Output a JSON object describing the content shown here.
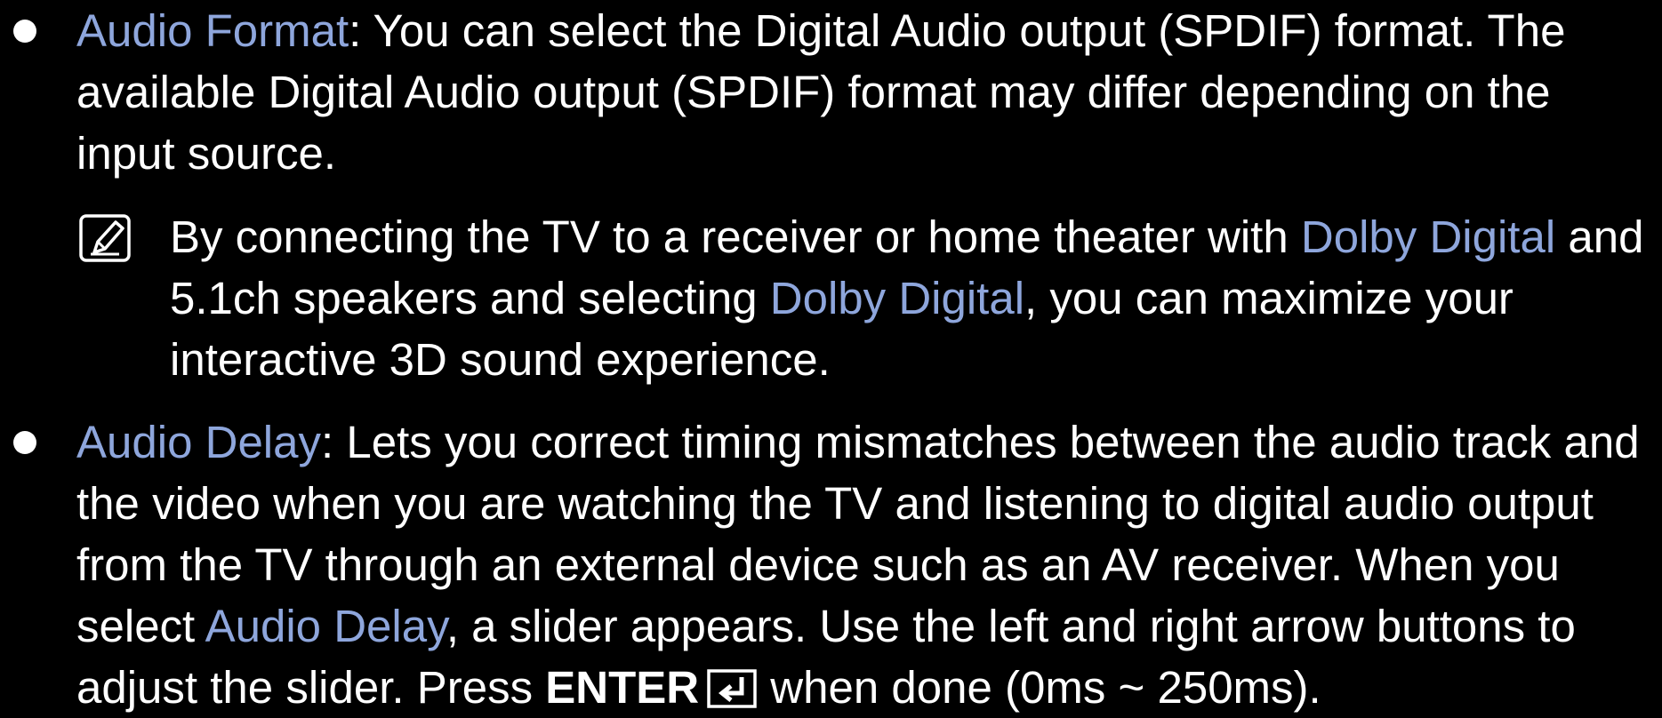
{
  "items": [
    {
      "term": "Audio Format",
      "text": ": You can select the Digital Audio output (SPDIF) format. The available Digital Audio output (SPDIF) format may differ depending on the input source."
    },
    {
      "term": "Audio Delay",
      "text_1": ": Lets you correct timing mismatches between the audio track and the video when you are watching the TV and listening to digital audio output from the TV through an external device such as an AV receiver. When you select ",
      "term_2": "Audio Delay",
      "text_2": ", a slider appears. Use the left and right arrow buttons to adjust the slider. Press ",
      "key": "ENTER",
      "key_icon": "enter-key-icon",
      "text_3": " when done (0ms ~ 250ms)."
    }
  ],
  "note": {
    "icon": "note-icon",
    "text_1": "By connecting the TV to a receiver or home theater with ",
    "term_1": "Dolby Digital",
    "text_2": " and 5.1ch speakers and selecting ",
    "term_2": "Dolby Digital",
    "text_3": ", you can maximize your interactive 3D sound experience."
  },
  "colors": {
    "background": "#000000",
    "text": "#ffffff",
    "highlight": "#8ea6dc"
  }
}
